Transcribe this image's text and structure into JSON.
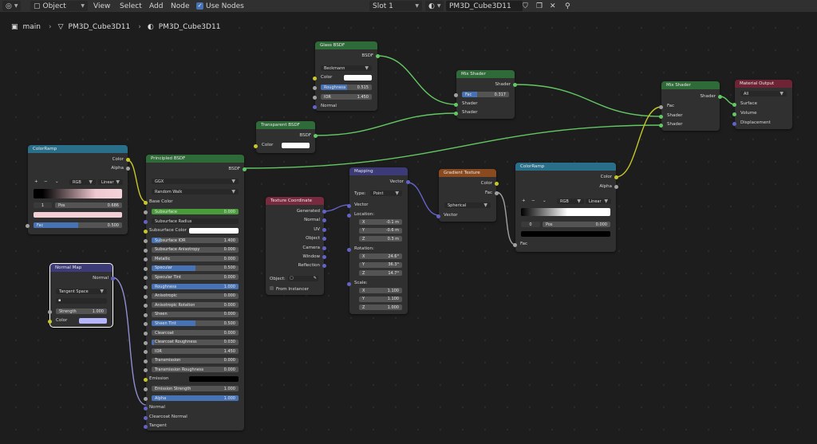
{
  "header": {
    "mode": "Object",
    "menus": [
      "View",
      "Select",
      "Add",
      "Node"
    ],
    "use_nodes": "Use Nodes",
    "slot": "Slot 1",
    "material": "PM3D_Cube3D11"
  },
  "breadcrumb": [
    "main",
    "PM3D_Cube3D11",
    "PM3D_Cube3D11"
  ],
  "nodes": {
    "glass": {
      "title": "Glass BSDF",
      "out": "BSDF",
      "dist": "Beckmann",
      "color": "Color",
      "roughness": "Roughness",
      "roughness_val": "0.515",
      "roughness_frac": 0.515,
      "ior": "IOR",
      "ior_val": "1.450",
      "normal": "Normal"
    },
    "transparent": {
      "title": "Transparent BSDF",
      "out": "BSDF",
      "color": "Color"
    },
    "mix1": {
      "title": "Mix Shader",
      "out": "Shader",
      "fac": "Fac",
      "fac_val": "0.317",
      "fac_frac": 0.317,
      "in1": "Shader",
      "in2": "Shader"
    },
    "mix2": {
      "title": "Mix Shader",
      "out": "Shader",
      "fac": "Fac",
      "in1": "Shader",
      "in2": "Shader"
    },
    "output": {
      "title": "Material Output",
      "target": "All",
      "surface": "Surface",
      "volume": "Volume",
      "displacement": "Displacement"
    },
    "ramp1": {
      "title": "ColorRamp",
      "out_color": "Color",
      "out_alpha": "Alpha",
      "mode": "RGB",
      "interp": "Linear",
      "index": "1",
      "pos": "Pos",
      "pos_val": "0.686",
      "fac": "Fac",
      "fac_val": "0.500",
      "fac_frac": 0.5
    },
    "normalmap": {
      "title": "Normal Map",
      "out": "Normal",
      "space": "Tangent Space",
      "strength": "Strength",
      "strength_val": "1.000",
      "color": "Color"
    },
    "principled": {
      "title": "Principled BSDF",
      "out": "BSDF",
      "dist": "GGX",
      "sss": "Random Walk",
      "base_color": "Base Color",
      "subsurface": "Subsurface",
      "subsurface_val": "0.000",
      "subsurface_radius": "Subsurface Radius",
      "subsurface_color": "Subsurface Color",
      "params": [
        {
          "label": "Subsurface IOR",
          "val": "1.400",
          "frac": 0.1
        },
        {
          "label": "Subsurface Anisotropy",
          "val": "0.000",
          "frac": 0
        },
        {
          "label": "Metallic",
          "val": "0.000",
          "frac": 0
        },
        {
          "label": "Specular",
          "val": "0.500",
          "frac": 0.5
        },
        {
          "label": "Specular Tint",
          "val": "0.000",
          "frac": 0
        },
        {
          "label": "Roughness",
          "val": "1.000",
          "frac": 1
        },
        {
          "label": "Anisotropic",
          "val": "0.000",
          "frac": 0
        },
        {
          "label": "Anisotropic Rotation",
          "val": "0.000",
          "frac": 0
        },
        {
          "label": "Sheen",
          "val": "0.000",
          "frac": 0
        },
        {
          "label": "Sheen Tint",
          "val": "0.500",
          "frac": 0.5
        },
        {
          "label": "Clearcoat",
          "val": "0.000",
          "frac": 0
        },
        {
          "label": "Clearcoat Roughness",
          "val": "0.030",
          "frac": 0.03
        },
        {
          "label": "IOR",
          "val": "1.450",
          "frac": 0
        },
        {
          "label": "Transmission",
          "val": "0.000",
          "frac": 0
        },
        {
          "label": "Transmission Roughness",
          "val": "0.000",
          "frac": 0
        }
      ],
      "emission": "Emission",
      "emission_strength": "Emission Strength",
      "emission_strength_val": "1.000",
      "alpha": "Alpha",
      "alpha_val": "1.000",
      "normal": "Normal",
      "clearcoat_normal": "Clearcoat Normal",
      "tangent": "Tangent"
    },
    "texcoord": {
      "title": "Texture Coordinate",
      "outputs": [
        "Generated",
        "Normal",
        "UV",
        "Object",
        "Camera",
        "Window",
        "Reflection"
      ],
      "object": "Object:",
      "from_instancer": "From Instancer"
    },
    "mapping": {
      "title": "Mapping",
      "out": "Vector",
      "type_label": "Type:",
      "type": "Point",
      "vector": "Vector",
      "location": "Location:",
      "loc": [
        {
          "a": "X",
          "v": "-0.1 m"
        },
        {
          "a": "Y",
          "v": "-0.6 m"
        },
        {
          "a": "Z",
          "v": "0.3 m"
        }
      ],
      "rotation": "Rotation:",
      "rot": [
        {
          "a": "X",
          "v": "24.6°"
        },
        {
          "a": "Y",
          "v": "36.3°"
        },
        {
          "a": "Z",
          "v": "14.7°"
        }
      ],
      "scale": "Scale:",
      "scl": [
        {
          "a": "X",
          "v": "1.100"
        },
        {
          "a": "Y",
          "v": "1.100"
        },
        {
          "a": "Z",
          "v": "1.000"
        }
      ]
    },
    "gradient": {
      "title": "Gradient Texture",
      "out_color": "Color",
      "out_fac": "Fac",
      "type": "Spherical",
      "vector": "Vector"
    },
    "ramp2": {
      "title": "ColorRamp",
      "out_color": "Color",
      "out_alpha": "Alpha",
      "mode": "RGB",
      "interp": "Linear",
      "index": "0",
      "pos": "Pos",
      "pos_val": "0.000",
      "fac": "Fac"
    }
  },
  "colors": {
    "socket_shader": "#63c763",
    "socket_color": "#c7c729",
    "socket_vector": "#6363c7",
    "socket_float": "#a1a1a1"
  }
}
